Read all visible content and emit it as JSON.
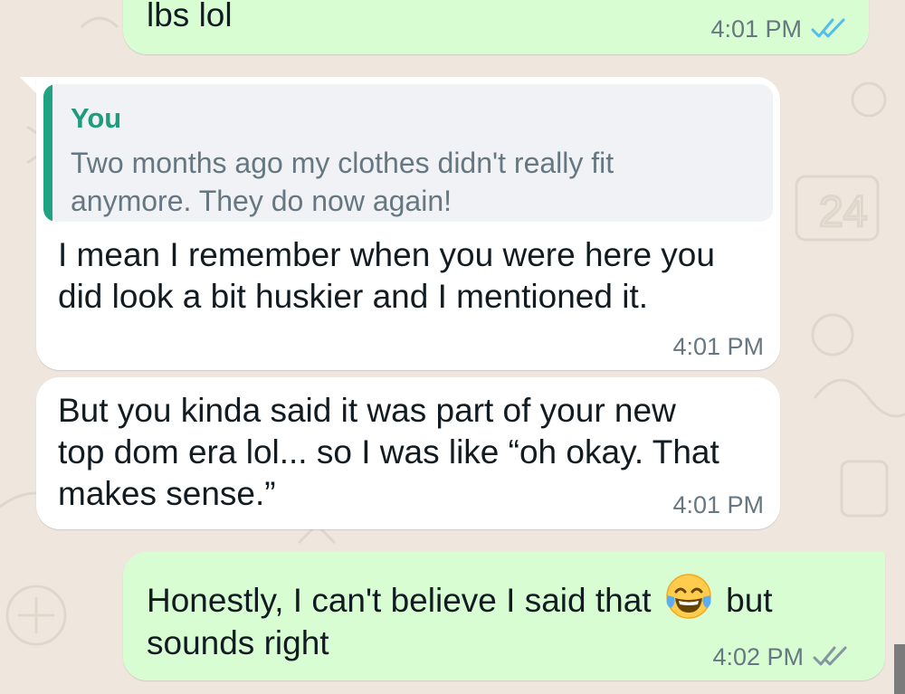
{
  "colors": {
    "chat_background": "#efe7de",
    "outgoing_bubble": "#d9fdd3",
    "incoming_bubble": "#ffffff",
    "quote_accent": "#1fa382",
    "read_ticks": "#53bdeb",
    "delivered_ticks": "#8696a0"
  },
  "messages": [
    {
      "text": "lbs lol",
      "time": "4:01 PM",
      "status_icon": "double-check-blue-icon"
    },
    {
      "quote": {
        "author": "You",
        "text": "Two months ago my clothes didn't really fit\nanymore. They do now again!"
      },
      "text": "I mean I remember when you were here you\ndid look a bit huskier and I mentioned it.",
      "time": "4:01 PM"
    },
    {
      "text": "But you kinda said it was part of your new\ntop dom era lol... so I was like “oh okay. That\nmakes sense.”",
      "time": "4:01 PM"
    },
    {
      "text_before_emoji": "Honestly, I can't believe I said that ",
      "emoji": "face-with-tears-of-joy-emoji",
      "text_after_emoji": " but",
      "text_line2": "sounds right",
      "time": "4:02 PM",
      "status_icon": "double-check-grey-icon"
    }
  ]
}
